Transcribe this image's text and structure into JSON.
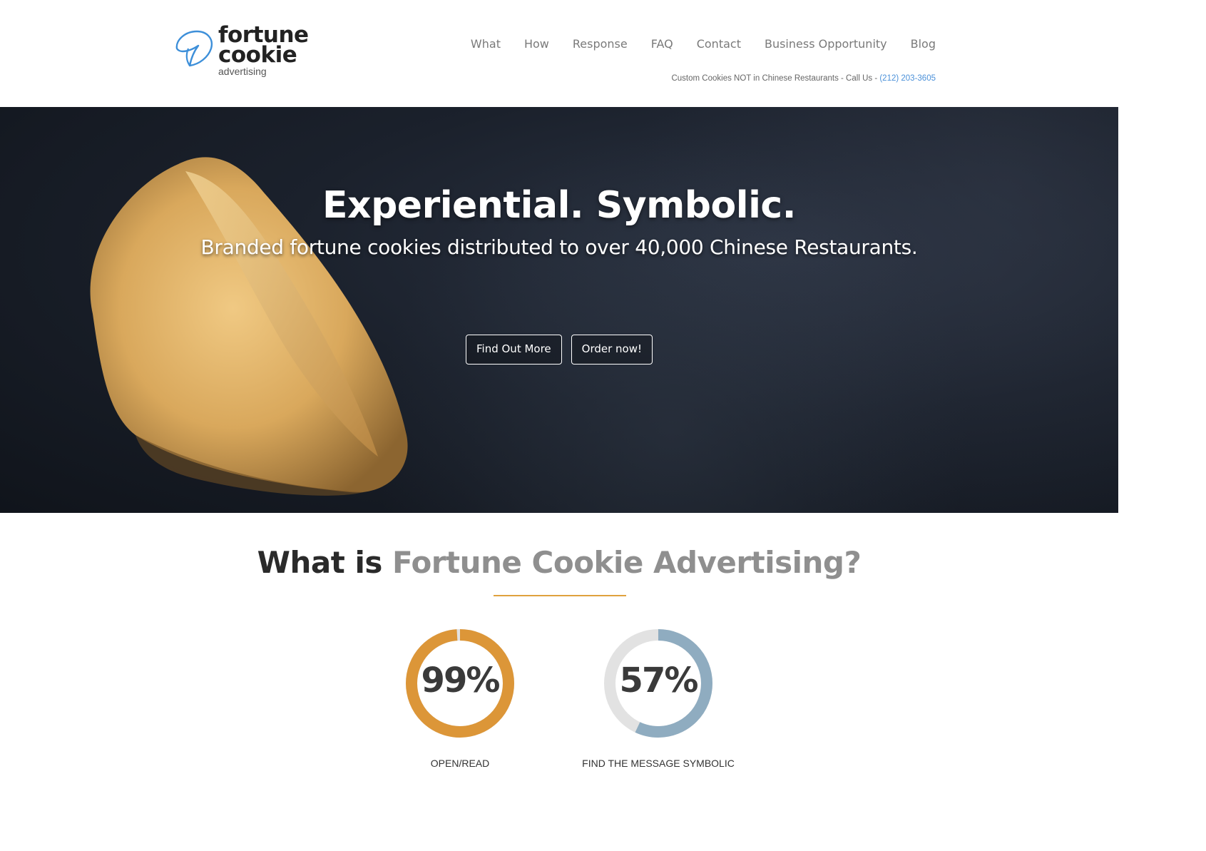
{
  "brand": {
    "word1": "fortune",
    "word2": "cookie",
    "word3": "advertising",
    "icon": "fortune-cookie-outline-icon",
    "icon_color": "#3d8fd9"
  },
  "nav": {
    "items": [
      {
        "label": "What"
      },
      {
        "label": "How"
      },
      {
        "label": "Response"
      },
      {
        "label": "FAQ"
      },
      {
        "label": "Contact"
      },
      {
        "label": "Business Opportunity"
      },
      {
        "label": "Blog"
      }
    ]
  },
  "tagline": {
    "text": "Custom Cookies NOT in Chinese Restaurants - Call Us - ",
    "phone": "(212) 203-3605"
  },
  "hero": {
    "title": "Experiential. Symbolic.",
    "subtitle": "Branded fortune cookies distributed to over 40,000 Chinese Restaurants.",
    "buttons": {
      "find_out_more": "Find Out More",
      "order_now": "Order now!"
    }
  },
  "what": {
    "title_plain": "What is ",
    "title_accent": "Fortune Cookie Advertising?"
  },
  "stats": [
    {
      "value": "99%",
      "label": "OPEN/READ",
      "percent": 99,
      "color": "#dc9638"
    },
    {
      "value": "57%",
      "label": "FIND THE MESSAGE SYMBOLIC",
      "percent": 57,
      "color": "#8facc0"
    }
  ],
  "colors": {
    "accent": "#e0a23e",
    "link": "#4a90d9",
    "track": "#e2e2e2"
  }
}
